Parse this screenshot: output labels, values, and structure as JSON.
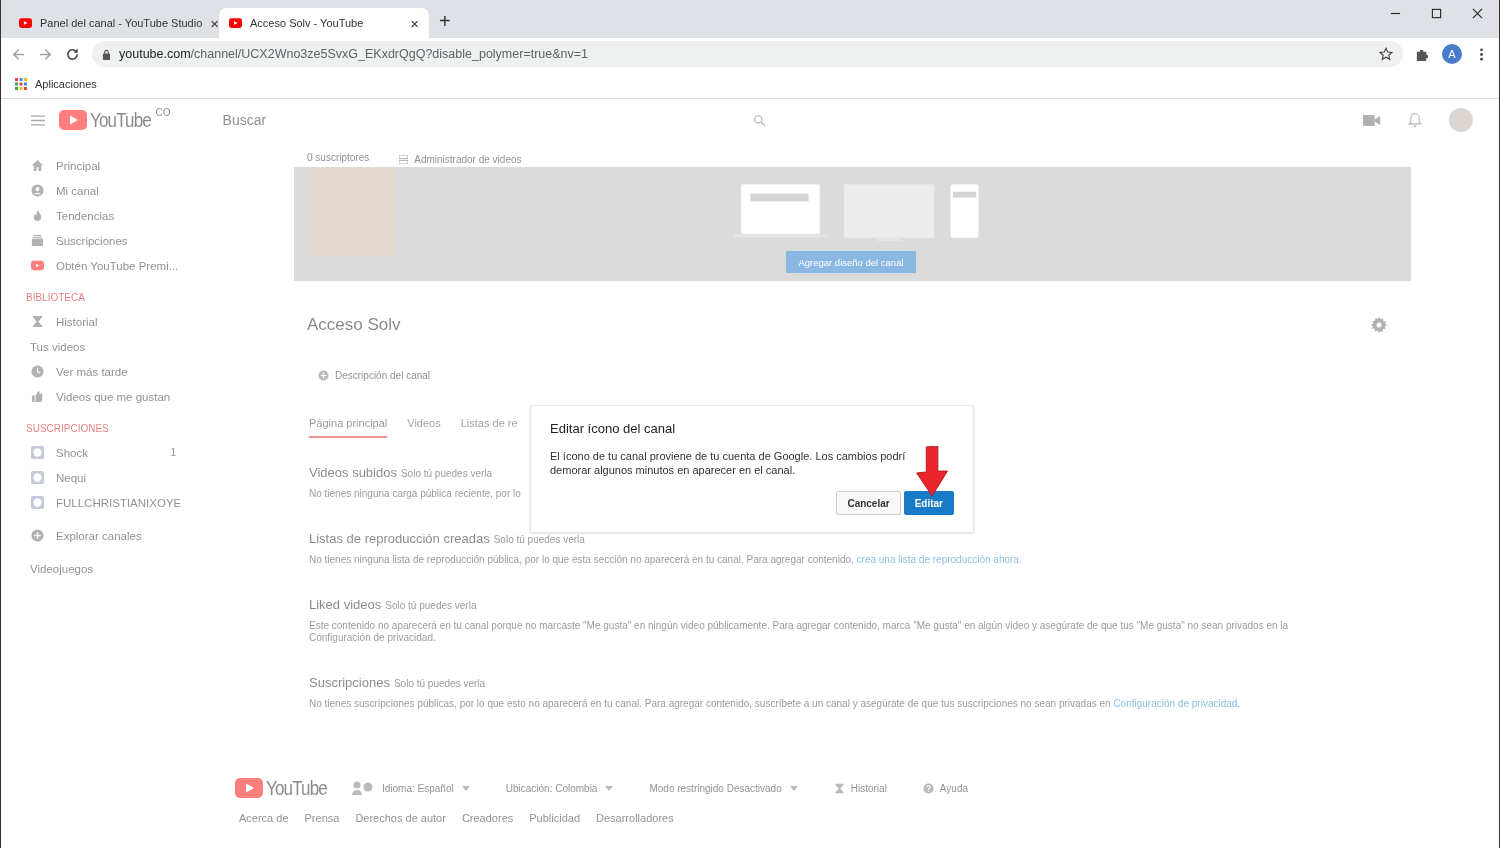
{
  "browser": {
    "tabs": [
      {
        "title": "Panel del canal - YouTube Studio",
        "selected": false,
        "close": "×"
      },
      {
        "title": "Acceso Solv - YouTube",
        "selected": true,
        "close": "×"
      }
    ],
    "new_tab": "+",
    "url": {
      "domain": "youtube.com",
      "path": "/channel/UCX2Wno3ze5SvxG_EKxdrQgQ?disable_polymer=true&nv=1"
    },
    "profile": "A",
    "bookmarks": [
      {
        "label": "Aplicaciones"
      }
    ]
  },
  "masthead": {
    "logo": "YouTube",
    "region": "CO",
    "search": {
      "placeholder": "Buscar"
    }
  },
  "sidebar": [
    {
      "items": [
        {
          "kind": "home",
          "label": "Principal"
        },
        {
          "kind": "channel",
          "label": "Mi canal"
        },
        {
          "kind": "trending",
          "label": "Tendencias"
        },
        {
          "kind": "subs",
          "label": "Suscripciones"
        },
        {
          "kind": "premium",
          "label": "Obtén YouTube Premi..."
        }
      ]
    },
    {
      "heading": "BIBLIOTECA",
      "items": [
        {
          "kind": "history",
          "label": "Historial"
        },
        {
          "kind": "plain",
          "label": "Tus videos"
        },
        {
          "kind": "clock",
          "label": "Ver más tarde"
        },
        {
          "kind": "like",
          "label": "Videos que me gustan"
        }
      ]
    },
    {
      "heading": "SUSCRIPCIONES",
      "items": [
        {
          "kind": "avatar",
          "label": "Shock",
          "count": "1"
        },
        {
          "kind": "avatar",
          "label": "Nequi"
        },
        {
          "kind": "avatar",
          "label": "FULLCHRISTIANIXOYE"
        }
      ]
    },
    {
      "items": [
        {
          "kind": "explore",
          "label": "Explorar canales"
        }
      ]
    },
    {
      "items": [
        {
          "kind": "plain",
          "label": "Videojuegos"
        }
      ]
    }
  ],
  "channel": {
    "subscribers": "0 suscriptores",
    "manager": "Administrador de videos",
    "banner_button": "Agregar diseño del canal",
    "name": "Acceso Solv",
    "description": "Descripción del canal",
    "tabs": [
      {
        "label": "Página principal",
        "selected": true
      },
      {
        "label": "Videos",
        "selected": false
      },
      {
        "label": "Listas de re",
        "selected": false
      }
    ],
    "sections": [
      {
        "title": "Videos subidos",
        "badge": "Solo tú puedes verla",
        "text": "No tienes ninguna carga pública reciente, por lo"
      },
      {
        "title": "Listas de reproducción creadas",
        "badge": "Solo tú puedes verla",
        "text": "No tienes ninguna lista de reproducción pública, por lo que esta sección no aparecerá en tu canal. Para agregar contenido, ",
        "link": "crea una lista de reproducción ahora."
      },
      {
        "title": "Liked videos",
        "badge": "Solo tú puedes verla",
        "text": "Este contenido no aparecerá en tu canal porque no marcaste \"Me gusta\" en ningún video públicamente. Para agregar contenido, marca \"Me gusta\" en algún video y asegúrate de que tus \"Me gusta\" no sean privados en la Configuración de privacidad."
      },
      {
        "title": "Suscripciones",
        "badge": "Solo tú puedes verla",
        "text": "No tienes suscripciones públicas, por lo que esto no aparecerá en tu canal. Para agregar contenido, suscríbete a un canal y asegúrate de que tus suscripciones no sean privadas en ",
        "link": "Configuración de privacidad",
        "after": "."
      }
    ]
  },
  "footer": {
    "logo": "YouTube",
    "options": [
      {
        "kind": "dropdown",
        "label": "Idioma: Español"
      },
      {
        "kind": "dropdown",
        "label": "Ubicación: Colombia"
      },
      {
        "kind": "dropdown",
        "label": "Modo restringido Desactivado"
      },
      {
        "kind": "history",
        "label": "Historial"
      },
      {
        "kind": "help",
        "label": "Ayuda"
      }
    ],
    "links": [
      "Acerca de",
      "Prensa",
      "Derechos de autor",
      "Creadores",
      "Publicidad",
      "Desarrolladores"
    ]
  },
  "dialog": {
    "title": "Editar ícono del canal",
    "lines": [
      "El ícono de tu canal proviene de tu cuenta de Google. Los cambios podrí",
      "demorar algunos minutos en aparecer en el canal."
    ],
    "buttons": [
      {
        "kind": "secondary",
        "label": "Cancelar"
      },
      {
        "kind": "primary",
        "label": "Editar"
      }
    ]
  }
}
